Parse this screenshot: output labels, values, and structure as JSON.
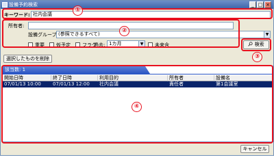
{
  "window": {
    "title": "設備予約検索",
    "buttons": {
      "minimize": "_",
      "maximize": "□",
      "close": "×"
    }
  },
  "keyword": {
    "label": "キーワード:",
    "value": "社内会議"
  },
  "filters": {
    "owner_label": "所有者:",
    "owner_value": "",
    "group_label": "設備グループ:",
    "group_value": "(参照できるすべて)",
    "checkboxes": [
      {
        "label": "重要"
      },
      {
        "label": "仮予定"
      },
      {
        "label": "フラグ"
      }
    ],
    "past_label": "過去:",
    "past_value": "1カ月",
    "future_label": "未来含"
  },
  "search_button": {
    "label": "検索"
  },
  "delete_selected_button": {
    "label": "選択したものを削除"
  },
  "results": {
    "tab_label": "該当数: 1",
    "columns": [
      "開始日時",
      "終了日時",
      "利用目的",
      "所有者",
      "設備名"
    ],
    "rows": [
      [
        "07/01/13 10:00",
        "07/01/13 12:00",
        "社内会議",
        "責任者",
        "第1会議室"
      ]
    ]
  },
  "cancel_button": {
    "label": "キャンセル"
  },
  "callouts": [
    "①",
    "②",
    "③",
    "④"
  ],
  "colors": {
    "callout": "#e8101e",
    "selection": "#0a246a",
    "tab": "#2a55c4"
  }
}
